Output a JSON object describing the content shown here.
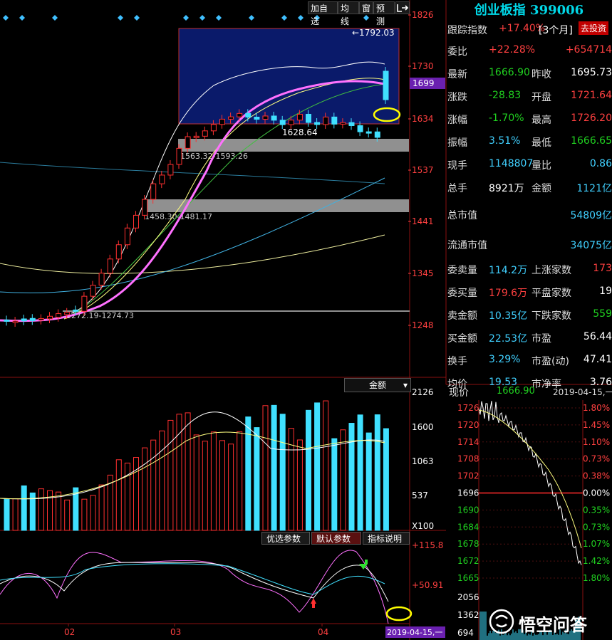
{
  "toolbar": {
    "add_watchlist": "加自选",
    "ma_lines": "均线",
    "window": "窗",
    "alert": "预测"
  },
  "main_chart": {
    "price_axis": [
      "1826",
      "1730",
      "1634",
      "1537",
      "1441",
      "1345",
      "1248"
    ],
    "current_price_tag": "1699",
    "high_label": "1792.03",
    "low_label": "1628.64",
    "gap1_label": "1563.32-1593.26",
    "gap2_label": "1458.30-1481.17",
    "gap3_label": "1272.19-1274.73"
  },
  "volume_panel": {
    "indicator_select": "金额",
    "axis": [
      "2126",
      "1600",
      "1063",
      "537",
      "X100"
    ]
  },
  "osc_panel": {
    "tabs": [
      "优选参数",
      "默认参数",
      "指标说明"
    ],
    "axis": [
      "+115.8",
      "+50.91"
    ],
    "date_tag": "2019-04-15,一"
  },
  "x_axis": [
    "02",
    "03",
    "04"
  ],
  "quote": {
    "title": "创业板指 399006",
    "tracking_label": "跟踪指数",
    "tracking_value": "+17.40%",
    "tracking_period": "[3个月]",
    "invest_button": "去投资",
    "rows": [
      {
        "l1": "委比",
        "v1": "+22.28%",
        "v1c": "red",
        "l2": "",
        "v2": "+654714",
        "v2c": "red"
      },
      {
        "l1": "最新",
        "v1": "1666.90",
        "v1c": "grn",
        "l2": "昨收",
        "v2": "1695.73",
        "v2c": "wht"
      },
      {
        "l1": "涨跌",
        "v1": "-28.83",
        "v1c": "grn",
        "l2": "开盘",
        "v2": "1721.64",
        "v2c": "red"
      },
      {
        "l1": "涨幅",
        "v1": "-1.70%",
        "v1c": "grn",
        "l2": "最高",
        "v2": "1726.20",
        "v2c": "red"
      },
      {
        "l1": "振幅",
        "v1": "3.51%",
        "v1c": "cyn",
        "l2": "最低",
        "v2": "1666.65",
        "v2c": "grn"
      },
      {
        "l1": "现手",
        "v1": "1148807",
        "v1c": "cyn",
        "l2": "量比",
        "v2": "0.86",
        "v2c": "cyn"
      },
      {
        "l1": "总手",
        "v1": "8921万",
        "v1c": "wht",
        "l2": "金额",
        "v2": "1121亿",
        "v2c": "cyn"
      }
    ],
    "mktcap_label": "总市值",
    "mktcap_value": "54809亿",
    "float_label": "流通市值",
    "float_value": "34075亿",
    "rows2": [
      {
        "l1": "委卖量",
        "v1": "114.2万",
        "v1c": "cyn",
        "l2": "上涨家数",
        "v2": "173",
        "v2c": "red"
      },
      {
        "l1": "委买量",
        "v1": "179.6万",
        "v1c": "red",
        "l2": "平盘家数",
        "v2": "19",
        "v2c": "wht"
      },
      {
        "l1": "卖金额",
        "v1": "10.35亿",
        "v1c": "cyn",
        "l2": "下跌家数",
        "v2": "559",
        "v2c": "grn"
      },
      {
        "l1": "买金额",
        "v1": "22.53亿",
        "v1c": "cyn",
        "l2": "市盈",
        "v2": "56.44",
        "v2c": "wht"
      },
      {
        "l1": "换手",
        "v1": "3.29%",
        "v1c": "cyn",
        "l2": "市盈(动)",
        "v2": "47.41",
        "v2c": "wht"
      },
      {
        "l1": "均价",
        "v1": "19.53",
        "v1c": "cyn",
        "l2": "市净率",
        "v2": "3.76",
        "v2c": "wht"
      }
    ]
  },
  "intraday": {
    "price_label": "现价",
    "price_value": "1666.90",
    "date": "2019-04-15,一",
    "left_axis": [
      "1726",
      "1720",
      "1714",
      "1708",
      "1702",
      "1696",
      "1690",
      "1684",
      "1678",
      "1672",
      "1665"
    ],
    "right_axis": [
      "1.80%",
      "1.45%",
      "1.10%",
      "0.73%",
      "0.38%",
      "0.00%",
      "0.35%",
      "0.73%",
      "1.07%",
      "1.42%",
      "1.80%"
    ],
    "vol_axis": [
      "2056",
      "1362",
      "694"
    ]
  },
  "watermark": "悟空问答",
  "colors": {
    "up": "#ff3030",
    "down": "#40e0ff",
    "ma_pink": "#ff70ff",
    "ma_yellow": "#ffff80",
    "ma_green": "#40c040",
    "highlight": "#ffff00"
  }
}
